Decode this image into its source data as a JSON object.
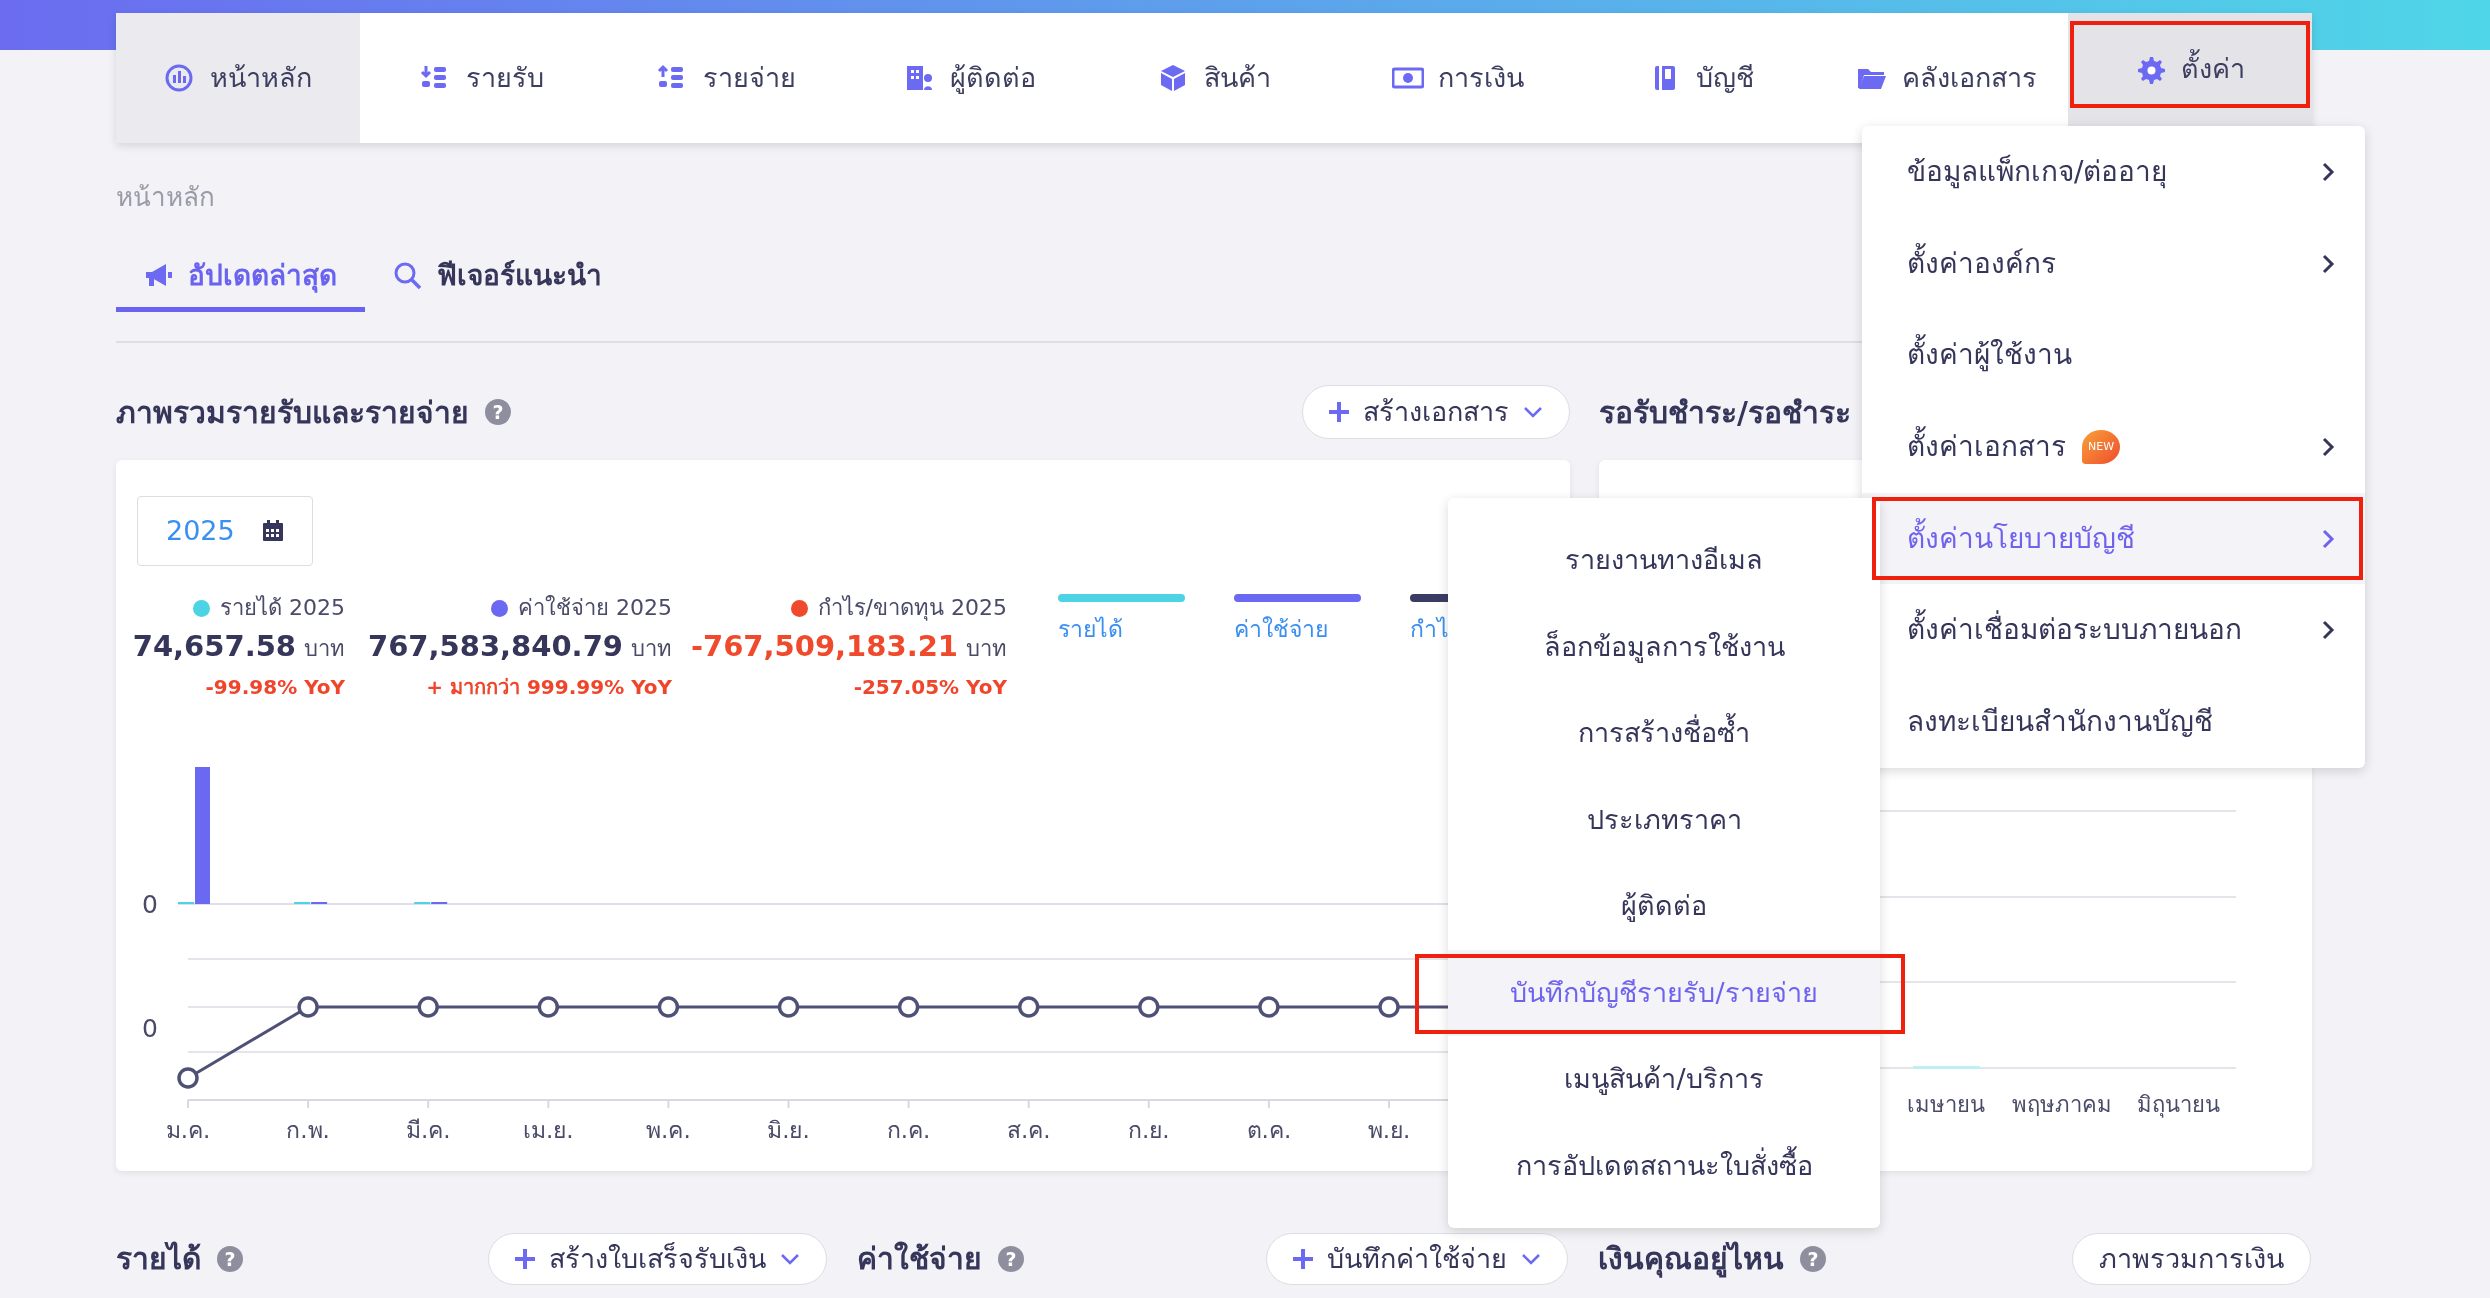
{
  "nav": [
    {
      "label": "หน้าหลัก",
      "selected": true,
      "expanded": false,
      "highlighted": false
    },
    {
      "label": "รายรับ",
      "selected": false,
      "expanded": false,
      "highlighted": false
    },
    {
      "label": "รายจ่าย",
      "selected": false,
      "expanded": false,
      "highlighted": false
    },
    {
      "label": "ผู้ติดต่อ",
      "selected": false,
      "expanded": false,
      "highlighted": false
    },
    {
      "label": "สินค้า",
      "selected": false,
      "expanded": false,
      "highlighted": false
    },
    {
      "label": "การเงิน",
      "selected": false,
      "expanded": false,
      "highlighted": false
    },
    {
      "label": "บัญชี",
      "selected": false,
      "expanded": false,
      "highlighted": false
    },
    {
      "label": "คลังเอกสาร",
      "selected": false,
      "expanded": false,
      "highlighted": false
    },
    {
      "label": "ตั้งค่า",
      "selected": false,
      "expanded": true,
      "highlighted": true
    }
  ],
  "breadcrumb": "หน้าหลัก",
  "tabs": [
    {
      "label": "อัปเดตล่าสุด",
      "selected": true
    },
    {
      "label": "ฟีเจอร์แนะนำ",
      "selected": false
    }
  ],
  "overview": {
    "title": "ภาพรวมรายรับและรายจ่าย",
    "help": "?",
    "create_button": "สร้างเอกสาร",
    "year": "2025",
    "stats": [
      {
        "label": "รายได้ 2025",
        "value": "74,657.58",
        "unit": "บาท",
        "yoy": "-99.98% YoY",
        "color": "#4dd4e4",
        "negative": false
      },
      {
        "label": "ค่าใช้จ่าย 2025",
        "value": "767,583,840.79",
        "unit": "บาท",
        "yoy": "+ มากกว่า 999.99% YoY",
        "color": "#6b68f2",
        "negative": false
      },
      {
        "label": "กำไร/ขาดทุน 2025",
        "value": "-767,509,183.21",
        "unit": "บาท",
        "yoy": "-257.05% YoY",
        "color": "#f04a2c",
        "negative": true
      }
    ],
    "legend": [
      {
        "label": "รายได้",
        "color": "#4dd4e4"
      },
      {
        "label": "ค่าใช้จ่าย",
        "color": "#6b68f2"
      },
      {
        "label": "กำไ",
        "color": "#3b3c63"
      }
    ],
    "chart": {
      "y_labels": [
        "0",
        "0"
      ],
      "months": [
        "ม.ค.",
        "ก.พ.",
        "มี.ค.",
        "เม.ย.",
        "พ.ค.",
        "มิ.ย.",
        "ก.ค.",
        "ส.ค.",
        "ก.ย.",
        "ต.ค.",
        "พ.ย."
      ]
    }
  },
  "receivables": {
    "title": "รอรับชำระ/รอชำระ",
    "months": [
      "เมษายน",
      "พฤษภาคม",
      "มิถุนายน"
    ]
  },
  "bottom": [
    {
      "title": "รายได้",
      "help": "?",
      "button": "สร้างใบเสร็จรับเงิน",
      "kind": "dropdown"
    },
    {
      "title": "ค่าใช้จ่าย",
      "help": "?",
      "button": "บันทึกค่าใช้จ่าย",
      "kind": "dropdown"
    },
    {
      "title": "เงินคุณอยู่ไหน",
      "help": "?",
      "button": "ภาพรวมการเงิน",
      "kind": "plain"
    }
  ],
  "settings_menu": [
    {
      "label": "ข้อมูลแพ็กเกจ/ต่ออายุ",
      "has_submenu": true,
      "selected": false,
      "highlighted": false
    },
    {
      "label": "ตั้งค่าองค์กร",
      "has_submenu": true,
      "selected": false,
      "highlighted": false
    },
    {
      "label": "ตั้งค่าผู้ใช้งาน",
      "has_submenu": false,
      "selected": false,
      "highlighted": false
    },
    {
      "label": "ตั้งค่าเอกสาร",
      "has_submenu": true,
      "selected": false,
      "highlighted": false,
      "badge": "NEW"
    },
    {
      "label": "ตั้งค่านโยบายบัญชี",
      "has_submenu": true,
      "selected": true,
      "highlighted": true
    },
    {
      "label": "ตั้งค่าเชื่อมต่อระบบภายนอก",
      "has_submenu": true,
      "selected": false,
      "highlighted": false
    },
    {
      "label": "ลงทะเบียนสำนักงานบัญชี",
      "has_submenu": false,
      "selected": false,
      "highlighted": false
    }
  ],
  "submenu": [
    {
      "label": "รายงานทางอีเมล",
      "selected": false,
      "highlighted": false
    },
    {
      "label": "ล็อกข้อมูลการใช้งาน",
      "selected": false,
      "highlighted": false
    },
    {
      "label": "การสร้างชื่อซ้ำ",
      "selected": false,
      "highlighted": false
    },
    {
      "label": "ประเภทราคา",
      "selected": false,
      "highlighted": false
    },
    {
      "label": "ผู้ติดต่อ",
      "selected": false,
      "highlighted": false
    },
    {
      "label": "บันทึกบัญชีรายรับ/รายจ่าย",
      "selected": true,
      "highlighted": true
    },
    {
      "label": "เมนูสินค้า/บริการ",
      "selected": false,
      "highlighted": false
    },
    {
      "label": "การอัปเดตสถานะใบสั่งซื้อ",
      "selected": false,
      "highlighted": false
    }
  ]
}
